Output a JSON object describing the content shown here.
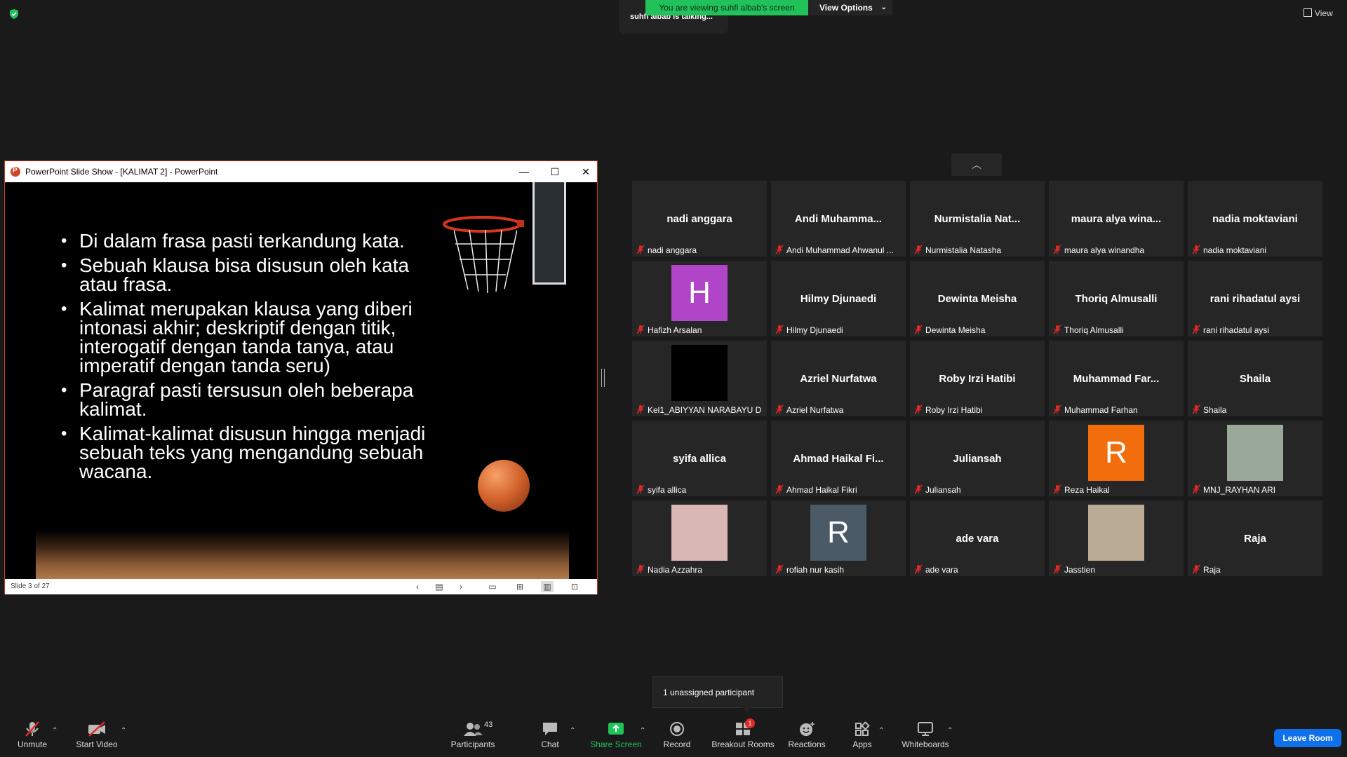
{
  "top": {
    "talking_text": "suhfi albab is talking...",
    "viewing_banner": "You are viewing suhfi albab's screen",
    "view_options": "View Options",
    "view_label": "View"
  },
  "ppt": {
    "window_title": "PowerPoint Slide Show - [KALIMAT 2] - PowerPoint",
    "bullets": [
      "Di dalam frasa pasti terkandung kata.",
      "Sebuah klausa bisa disusun oleh kata atau frasa.",
      "Kalimat merupakan klausa yang diberi intonasi akhir; deskriptif dengan titik, interogatif dengan tanda tanya, atau imperatif dengan tanda seru)",
      "Paragraf pasti tersusun oleh beberapa kalimat.",
      "Kalimat-kalimat disusun hingga menjadi sebuah teks yang mengandung sebuah wacana."
    ],
    "status": "Slide 3 of 27"
  },
  "tiles": [
    {
      "big": "nadi anggara",
      "name": "nadi anggara"
    },
    {
      "big": "Andi  Muhamma...",
      "name": "Andi Muhammad Ahwanul ..."
    },
    {
      "big": "Nurmistalia  Nat...",
      "name": "Nurmistalia Natasha"
    },
    {
      "big": "maura  alya  wina...",
      "name": "maura alya winandha"
    },
    {
      "big": "nadia moktaviani",
      "name": "nadia moktaviani"
    },
    {
      "big": "",
      "name": "Hafizh Arsalan",
      "avatar": "H",
      "avatar_color": "#b145c8"
    },
    {
      "big": "Hilmy Djunaedi",
      "name": "Hilmy Djunaedi"
    },
    {
      "big": "Dewinta Meisha",
      "name": "Dewinta Meisha"
    },
    {
      "big": "Thoriq Almusalli",
      "name": "Thoriq Almusalli"
    },
    {
      "big": "rani rihadatul aysi",
      "name": "rani rihadatul aysi"
    },
    {
      "big": "",
      "name": "Kel1_ABIYYAN NARABAYU D",
      "avatar": "",
      "avatar_color": "#000000"
    },
    {
      "big": "Azriel Nurfatwa",
      "name": "Azriel Nurfatwa"
    },
    {
      "big": "Roby Irzi Hatibi",
      "name": "Roby Irzi Hatibi"
    },
    {
      "big": "Muhammad  Far...",
      "name": "Muhammad Farhan"
    },
    {
      "big": "Shaila",
      "name": "Shaila"
    },
    {
      "big": "syifa allica",
      "name": "syifa allica"
    },
    {
      "big": "Ahmad  Haikal  Fi...",
      "name": "Ahmad Haikal Fikri"
    },
    {
      "big": "Juliansah",
      "name": "Juliansah"
    },
    {
      "big": "",
      "name": "Reza Haikal",
      "avatar": "R",
      "avatar_color": "#f26d0c"
    },
    {
      "big": "",
      "name": "MNJ_RAYHAN ARI",
      "avatar": "",
      "avatar_color": "#9aa89a"
    },
    {
      "big": "",
      "name": "Nadia Azzahra",
      "avatar": "",
      "avatar_color": "#d8b7b4"
    },
    {
      "big": "",
      "name": "rofiah nur kasih",
      "avatar": "R",
      "avatar_color": "#4a5a66"
    },
    {
      "big": "ade vara",
      "name": "ade vara"
    },
    {
      "big": "",
      "name": "Jasstien",
      "avatar": "",
      "avatar_color": "#b9ab94"
    },
    {
      "big": "Raja",
      "name": "Raja"
    }
  ],
  "popup": {
    "unassigned": "1 unassigned participant"
  },
  "toolbar": {
    "unmute": "Unmute",
    "start_video": "Start Video",
    "participants": "Participants",
    "participants_count": "43",
    "chat": "Chat",
    "share_screen": "Share Screen",
    "record": "Record",
    "breakout_rooms": "Breakout Rooms",
    "breakout_badge": "1",
    "reactions": "Reactions",
    "apps": "Apps",
    "whiteboards": "Whiteboards",
    "leave_room": "Leave Room"
  },
  "colors": {
    "accent_green": "#22c25b",
    "leave_blue": "#0e71eb",
    "mute_red": "#e02828"
  }
}
